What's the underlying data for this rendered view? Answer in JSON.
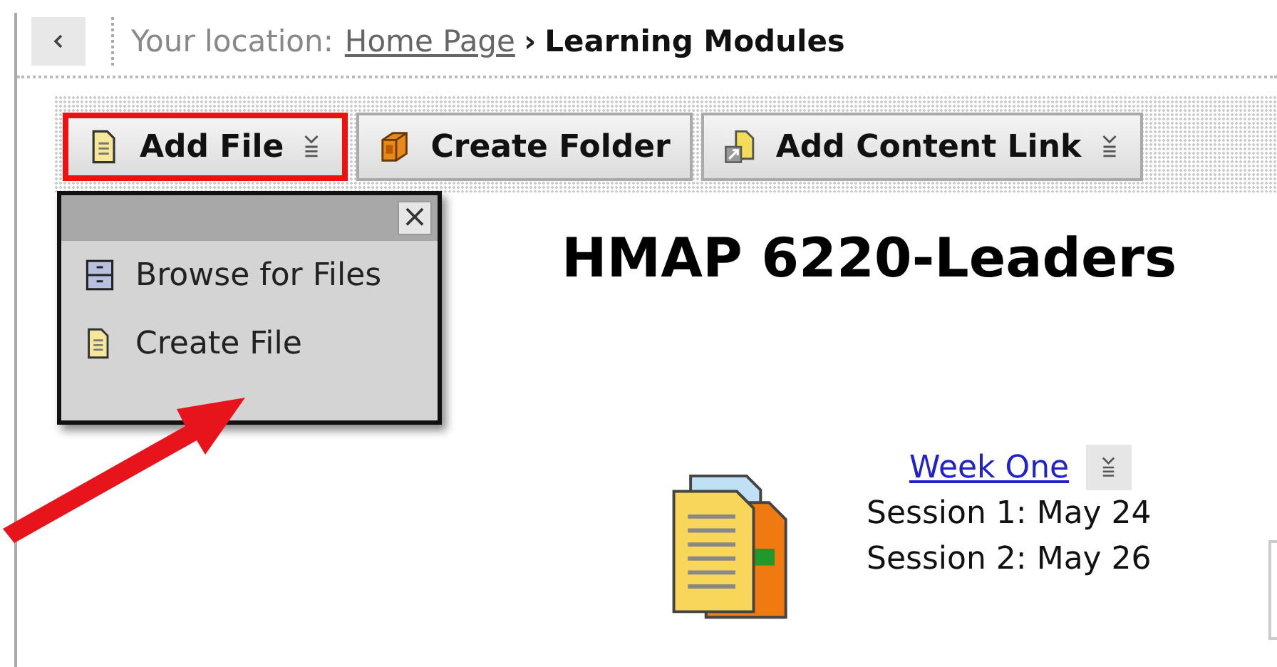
{
  "breadcrumb": {
    "label": "Your location:",
    "link": "Home Page",
    "separator": "›",
    "current": "Learning Modules"
  },
  "toolbar": [
    {
      "label": "Add File",
      "kind": "file",
      "has_menu": true,
      "highlighted": true
    },
    {
      "label": "Create Folder",
      "kind": "folder",
      "has_menu": false,
      "highlighted": false
    },
    {
      "label": "Add Content Link",
      "kind": "link",
      "has_menu": true,
      "highlighted": false
    }
  ],
  "menu": {
    "close": "×",
    "items": [
      {
        "label": "Browse for Files",
        "kind": "cabinet"
      },
      {
        "label": "Create File",
        "kind": "file"
      }
    ]
  },
  "heading": "HMAP 6220-Leaders",
  "content_items": [
    {
      "title": "Week One",
      "lines": [
        "Session 1: May 24",
        "Session 2: May 26"
      ]
    }
  ]
}
